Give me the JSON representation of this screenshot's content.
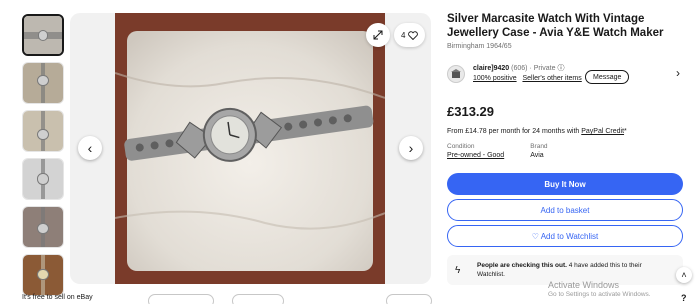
{
  "gallery": {
    "thumbnails": [
      {
        "name": "thumb-1",
        "active": true
      },
      {
        "name": "thumb-2",
        "active": false
      },
      {
        "name": "thumb-3",
        "active": false
      },
      {
        "name": "thumb-4",
        "active": false
      },
      {
        "name": "thumb-5",
        "active": false
      },
      {
        "name": "thumb-6",
        "active": false
      }
    ],
    "watch_count": "4"
  },
  "listing": {
    "title": "Silver Marcasite Watch With Vintage Jewellery Case - Avia Y&E Watch Maker",
    "subtitle": "Birmingham 1964/65",
    "price": "£313.29",
    "finance_text": "From £14.78 per month for 24 months with",
    "finance_link": "PayPal Credit",
    "finance_suffix": "*",
    "condition_label": "Condition",
    "condition_value": "Pre-owned - Good",
    "brand_label": "Brand",
    "brand_value": "Avia"
  },
  "seller": {
    "name": "claire]9420",
    "feedback": "(606)",
    "type": "· Private",
    "positive": "100% positive",
    "other_items": "Seller's other items",
    "message_label": "Message"
  },
  "actions": {
    "buy_now": "Buy It Now",
    "add_basket": "Add to basket",
    "add_watchlist": "♡ Add to Watchlist"
  },
  "notice": {
    "bold": "People are checking this out.",
    "rest": " 4 have added this to their",
    "line2": "Watchlist."
  },
  "footer": {
    "sell_text": "It's free to sell on eBay"
  },
  "os_overlay": {
    "activate_title": "Activate Windows",
    "activate_sub": "Go to Settings to activate Windows.",
    "help": "?"
  },
  "colors": {
    "accent": "#3665f3",
    "photo_background": "#7a3b2a"
  }
}
